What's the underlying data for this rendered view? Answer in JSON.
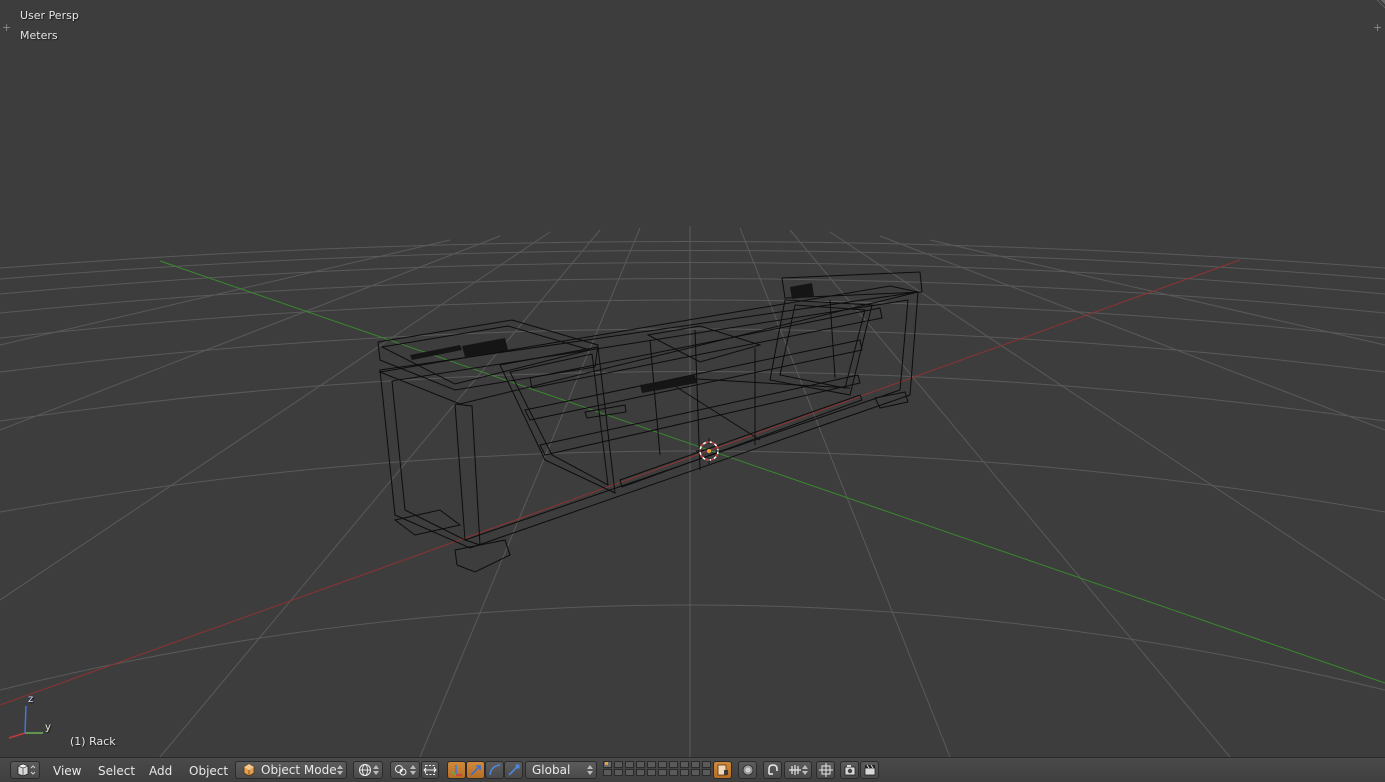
{
  "viewport": {
    "view_name": "User Persp",
    "units": "Meters",
    "active_object": "(1) Rack",
    "axis_labels": {
      "z": "z",
      "y": "y"
    }
  },
  "header": {
    "editor_type_icon": "3d-view-cube-icon",
    "menus": [
      {
        "label": "View"
      },
      {
        "label": "Select"
      },
      {
        "label": "Add"
      },
      {
        "label": "Object"
      }
    ],
    "mode": {
      "label": "Object Mode",
      "icon": "object-cube-icon"
    },
    "viewport_shading_icon": "wireframe-sphere-icon",
    "pivot_icon": "pivot-point-icon",
    "manipulator_icons": [
      "manipulator-toggle-icon",
      "translate-arrow-icon",
      "rotate-arc-icon",
      "scale-icon"
    ],
    "orientation": {
      "label": "Global"
    },
    "layer_icons": [
      "scene-layers-icon"
    ],
    "tool_icons": [
      "lock-layers-icon",
      "proportional-edit-icon",
      "snap-magnet-icon",
      "snap-element-icon",
      "snap-target-icon",
      "render-still-icon",
      "render-animation-icon"
    ],
    "accent_color": "#c7782e",
    "background_color": "#3d3d3d"
  }
}
